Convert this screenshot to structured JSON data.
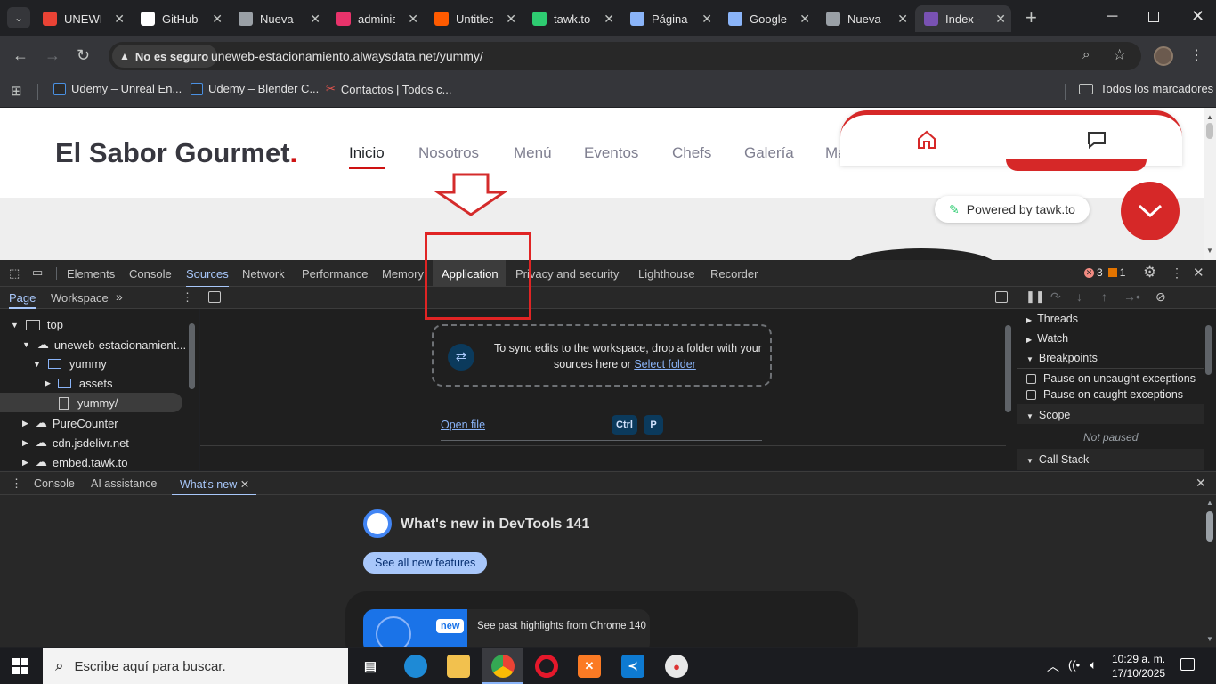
{
  "browser": {
    "tabs": [
      {
        "title": "UNEWEB",
        "icon": "gmail-icon",
        "color": "#ea4335"
      },
      {
        "title": "GitHub",
        "icon": "github-icon",
        "color": "#ffffff"
      },
      {
        "title": "Nueva pestaña",
        "icon": "chrome-icon",
        "color": "#9aa0a6"
      },
      {
        "title": "administ",
        "icon": "admin-icon",
        "color": "#e8336b"
      },
      {
        "title": "Untitled",
        "icon": "orange-square-icon",
        "color": "#ff5b00"
      },
      {
        "title": "tawk.to",
        "icon": "tawk-icon",
        "color": "#2ecc71"
      },
      {
        "title": "Página",
        "icon": "page-icon",
        "color": "#8ab4f8"
      },
      {
        "title": "Google",
        "icon": "gemini-icon",
        "color": "#8ab4f8"
      },
      {
        "title": "Nueva pestaña",
        "icon": "chrome-icon",
        "color": "#9aa0a6"
      },
      {
        "title": "Index -",
        "icon": "bootstrap-icon",
        "color": "#7952b3"
      }
    ],
    "new_tab": "+",
    "security_label": "No es seguro",
    "url": "uneweb-estacionamiento.alwaysdata.net/yummy/",
    "bookmarks": [
      {
        "label": "Udemy – Unreal En..."
      },
      {
        "label": "Udemy – Blender C..."
      },
      {
        "label": "Contactos | Todos c..."
      }
    ],
    "all_bookmarks": "Todos los marcadores"
  },
  "site": {
    "logo": "El Sabor Gourmet",
    "logo_dot": ".",
    "nav": [
      "Inicio",
      "Nosotros",
      "Menú",
      "Eventos",
      "Chefs",
      "Galería",
      "Ma"
    ],
    "active_nav": "Inicio",
    "powered_by": "Powered by tawk.to",
    "accent": "#ce1212"
  },
  "devtools": {
    "tabs": [
      "Elements",
      "Console",
      "Sources",
      "Network",
      "Performance",
      "Memory",
      "Application",
      "Privacy and security",
      "Lighthouse",
      "Recorder"
    ],
    "active_tab": "Sources",
    "error_count": "3",
    "warning_count": "1",
    "nav_tabs": [
      "Page",
      "Workspace"
    ],
    "tree": [
      {
        "label": "top"
      },
      {
        "label": "uneweb-estacionamient..."
      },
      {
        "label": "yummy"
      },
      {
        "label": "assets"
      },
      {
        "label": "yummy/"
      },
      {
        "label": "PureCounter"
      },
      {
        "label": "cdn.jsdelivr.net"
      },
      {
        "label": "embed.tawk.to"
      }
    ],
    "sync_text_1": "To sync edits to the workspace, drop a folder with your",
    "sync_text_2": "sources here or",
    "select_folder": "Select folder",
    "open_file": "Open file",
    "shortcut": [
      "Ctrl",
      "P"
    ],
    "right_sections": {
      "threads": "Threads",
      "watch": "Watch",
      "breakpoints": "Breakpoints",
      "uncaught": "Pause on uncaught exceptions",
      "caught": "Pause on caught exceptions",
      "scope": "Scope",
      "not_paused": "Not paused",
      "call_stack": "Call Stack"
    },
    "drawer_tabs": [
      "Console",
      "AI assistance",
      "What's new"
    ],
    "whats_new_title": "What's new in DevTools 141",
    "see_all": "See all new features",
    "highlights": "See past highlights from Chrome 140",
    "new_badge": "new"
  },
  "taskbar": {
    "search_placeholder": "Escribe aquí para buscar.",
    "time": "10:29 a. m.",
    "date": "17/10/2025"
  }
}
